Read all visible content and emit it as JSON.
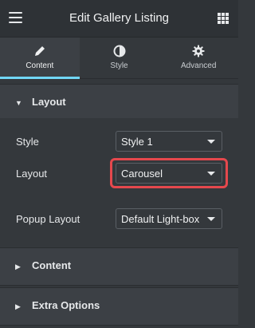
{
  "header": {
    "title": "Edit Gallery Listing",
    "menu_icon": "hamburger-menu-icon",
    "apps_icon": "grid-apps-icon"
  },
  "tabs": [
    {
      "label": "Content",
      "icon": "pencil-icon",
      "active": true
    },
    {
      "label": "Style",
      "icon": "contrast-circle-icon",
      "active": false
    },
    {
      "label": "Advanced",
      "icon": "gear-icon",
      "active": false
    }
  ],
  "sections": {
    "layout": {
      "title": "Layout",
      "expanded": true,
      "fields": [
        {
          "label": "Style",
          "value": "Style 1"
        },
        {
          "label": "Layout",
          "value": "Carousel"
        },
        {
          "label": "Popup Layout",
          "value": "Default Light-box"
        }
      ]
    },
    "content": {
      "title": "Content",
      "expanded": false
    },
    "extra": {
      "title": "Extra Options",
      "expanded": false
    }
  },
  "colors": {
    "accent": "#71d7f7",
    "highlight": "#e5484d",
    "panel": "#34383c"
  }
}
